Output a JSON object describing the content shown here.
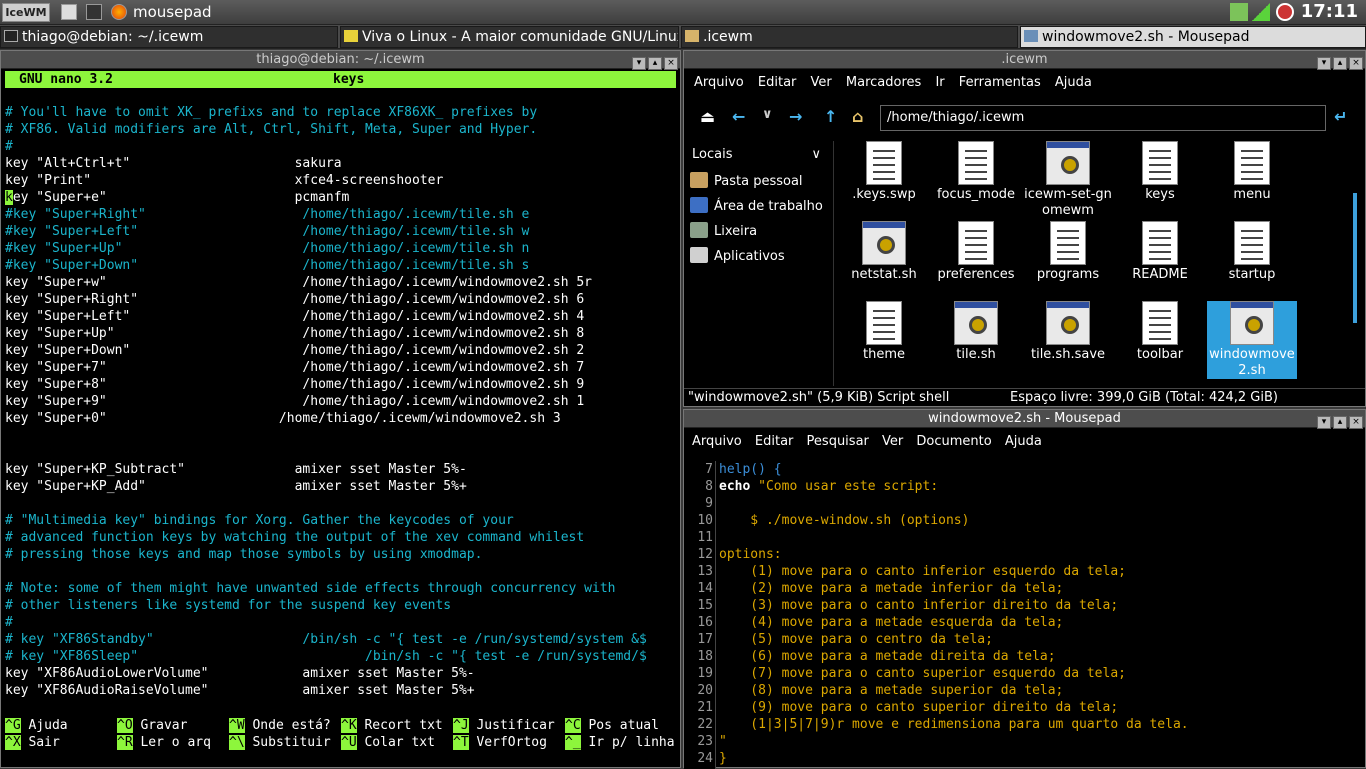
{
  "taskbar": {
    "start_label": "IceWM",
    "app_title": "mousepad",
    "clock": "17:11"
  },
  "tasks": [
    {
      "label": "thiago@debian: ~/.icewm"
    },
    {
      "label": "Viva o Linux - A maior comunidade GNU/Linux..."
    },
    {
      "label": ".icewm"
    },
    {
      "label": "windowmove2.sh - Mousepad"
    }
  ],
  "terminal": {
    "window_title": "thiago@debian: ~/.icewm",
    "nano_version": "GNU nano 3.2",
    "nano_file": "keys",
    "lines": [
      {
        "t": "# You'll have to omit XK_ prefixs and to replace XF86XK_ prefixes by",
        "c": true
      },
      {
        "t": "# XF86. Valid modifiers are Alt, Ctrl, Shift, Meta, Super and Hyper.",
        "c": true
      },
      {
        "t": "#",
        "c": true
      },
      {
        "t": "key \"Alt+Ctrl+t\"                     sakura",
        "c": false
      },
      {
        "t": "key \"Print\"                          xfce4-screenshooter",
        "c": false
      },
      {
        "t": "key \"Super+e\"                        pcmanfm",
        "c": false
      },
      {
        "t": "#key \"Super+Right\"                    /home/thiago/.icewm/tile.sh e",
        "c": true
      },
      {
        "t": "#key \"Super+Left\"                     /home/thiago/.icewm/tile.sh w",
        "c": true
      },
      {
        "t": "#key \"Super+Up\"                       /home/thiago/.icewm/tile.sh n",
        "c": true
      },
      {
        "t": "#key \"Super+Down\"                     /home/thiago/.icewm/tile.sh s",
        "c": true
      },
      {
        "t": "key \"Super+w\"                         /home/thiago/.icewm/windowmove2.sh 5r",
        "c": false
      },
      {
        "t": "key \"Super+Right\"                     /home/thiago/.icewm/windowmove2.sh 6",
        "c": false
      },
      {
        "t": "key \"Super+Left\"                      /home/thiago/.icewm/windowmove2.sh 4",
        "c": false
      },
      {
        "t": "key \"Super+Up\"                        /home/thiago/.icewm/windowmove2.sh 8",
        "c": false
      },
      {
        "t": "key \"Super+Down\"                      /home/thiago/.icewm/windowmove2.sh 2",
        "c": false
      },
      {
        "t": "key \"Super+7\"                         /home/thiago/.icewm/windowmove2.sh 7",
        "c": false
      },
      {
        "t": "key \"Super+8\"                         /home/thiago/.icewm/windowmove2.sh 9",
        "c": false
      },
      {
        "t": "key \"Super+9\"                         /home/thiago/.icewm/windowmove2.sh 1",
        "c": false
      },
      {
        "t": "key \"Super+0\"                      /home/thiago/.icewm/windowmove2.sh 3",
        "c": false
      },
      {
        "t": "",
        "c": false
      },
      {
        "t": "",
        "c": false
      },
      {
        "t": "key \"Super+KP_Subtract\"              amixer sset Master 5%-",
        "c": false
      },
      {
        "t": "key \"Super+KP_Add\"                   amixer sset Master 5%+",
        "c": false
      },
      {
        "t": "",
        "c": false
      },
      {
        "t": "# \"Multimedia key\" bindings for Xorg. Gather the keycodes of your",
        "c": true
      },
      {
        "t": "# advanced function keys by watching the output of the xev command whilest",
        "c": true
      },
      {
        "t": "# pressing those keys and map those symbols by using xmodmap.",
        "c": true
      },
      {
        "t": "",
        "c": false
      },
      {
        "t": "# Note: some of them might have unwanted side effects through concurrency with",
        "c": true
      },
      {
        "t": "# other listeners like systemd for the suspend key events",
        "c": true
      },
      {
        "t": "#",
        "c": true
      },
      {
        "t": "# key \"XF86Standby\"                   /bin/sh -c \"{ test -e /run/systemd/system &$",
        "c": true
      },
      {
        "t": "# key \"XF86Sleep\"                             /bin/sh -c \"{ test -e /run/systemd/$",
        "c": true
      },
      {
        "t": "key \"XF86AudioLowerVolume\"            amixer sset Master 5%-",
        "c": false
      },
      {
        "t": "key \"XF86AudioRaiseVolume\"            amixer sset Master 5%+",
        "c": false
      }
    ],
    "shortcuts_row1": [
      {
        "k": "^G",
        "l": "Ajuda"
      },
      {
        "k": "^O",
        "l": "Gravar"
      },
      {
        "k": "^W",
        "l": "Onde está?"
      },
      {
        "k": "^K",
        "l": "Recort txt"
      },
      {
        "k": "^J",
        "l": "Justificar"
      },
      {
        "k": "^C",
        "l": "Pos atual"
      }
    ],
    "shortcuts_row2": [
      {
        "k": "^X",
        "l": "Sair"
      },
      {
        "k": "^R",
        "l": "Ler o arq"
      },
      {
        "k": "^\\",
        "l": "Substituir"
      },
      {
        "k": "^U",
        "l": "Colar txt"
      },
      {
        "k": "^T",
        "l": "VerfOrtog"
      },
      {
        "k": "^_",
        "l": "Ir p/ linha"
      }
    ]
  },
  "filemanager": {
    "window_title": ".icewm",
    "menu": [
      "Arquivo",
      "Editar",
      "Ver",
      "Marcadores",
      "Ir",
      "Ferramentas",
      "Ajuda"
    ],
    "path": "/home/thiago/.icewm",
    "sidebar_header": "Locais",
    "sidebar": [
      {
        "label": "Pasta pessoal",
        "color": "#c8a060"
      },
      {
        "label": "Área de trabalho",
        "color": "#3d6fc4"
      },
      {
        "label": "Lixeira",
        "color": "#8aa08a"
      },
      {
        "label": "Aplicativos",
        "color": "#d0d0d0"
      }
    ],
    "files": [
      {
        "name": ".keys.swp",
        "kind": "doc"
      },
      {
        "name": "focus_mode",
        "kind": "doc"
      },
      {
        "name": "icewm-set-gnomewm",
        "kind": "exe"
      },
      {
        "name": "keys",
        "kind": "doc"
      },
      {
        "name": "menu",
        "kind": "doc"
      },
      {
        "name": "netstat.sh",
        "kind": "exe"
      },
      {
        "name": "preferences",
        "kind": "doc"
      },
      {
        "name": "programs",
        "kind": "doc"
      },
      {
        "name": "README",
        "kind": "doc"
      },
      {
        "name": "startup",
        "kind": "doc"
      },
      {
        "name": "theme",
        "kind": "doc"
      },
      {
        "name": "tile.sh",
        "kind": "exe"
      },
      {
        "name": "tile.sh.save",
        "kind": "exe"
      },
      {
        "name": "toolbar",
        "kind": "doc"
      },
      {
        "name": "windowmove2.sh",
        "kind": "exe",
        "selected": true
      }
    ],
    "status_left": "\"windowmove2.sh\" (5,9 KiB) Script shell",
    "status_right": "Espaço livre: 399,0 GiB (Total: 424,2 GiB)"
  },
  "mousepad": {
    "window_title": "windowmove2.sh - Mousepad",
    "menu": [
      "Arquivo",
      "Editar",
      "Pesquisar",
      "Ver",
      "Documento",
      "Ajuda"
    ],
    "line_numbers": [
      "7",
      "8",
      "9",
      "10",
      "11",
      "12",
      "13",
      "14",
      "15",
      "16",
      "17",
      "18",
      "19",
      "20",
      "21",
      "22",
      "23",
      "24"
    ],
    "code": [
      "help() {",
      "echo \"Como usar este script:",
      "",
      "    $ ./move-window.sh (options)",
      "",
      "options:",
      "    (1) move para o canto inferior esquerdo da tela;",
      "    (2) move para a metade inferior da tela;",
      "    (3) move para o canto inferior direito da tela;",
      "    (4) move para a metade esquerda da tela;",
      "    (5) move para o centro da tela;",
      "    (6) move para a metade direita da tela;",
      "    (7) move para o canto superior esquerdo da tela;",
      "    (8) move para a metade superior da tela;",
      "    (9) move para o canto superior direito da tela;",
      "    (1|3|5|7|9)r move e redimensiona para um quarto da tela.",
      "\"",
      "}"
    ]
  }
}
